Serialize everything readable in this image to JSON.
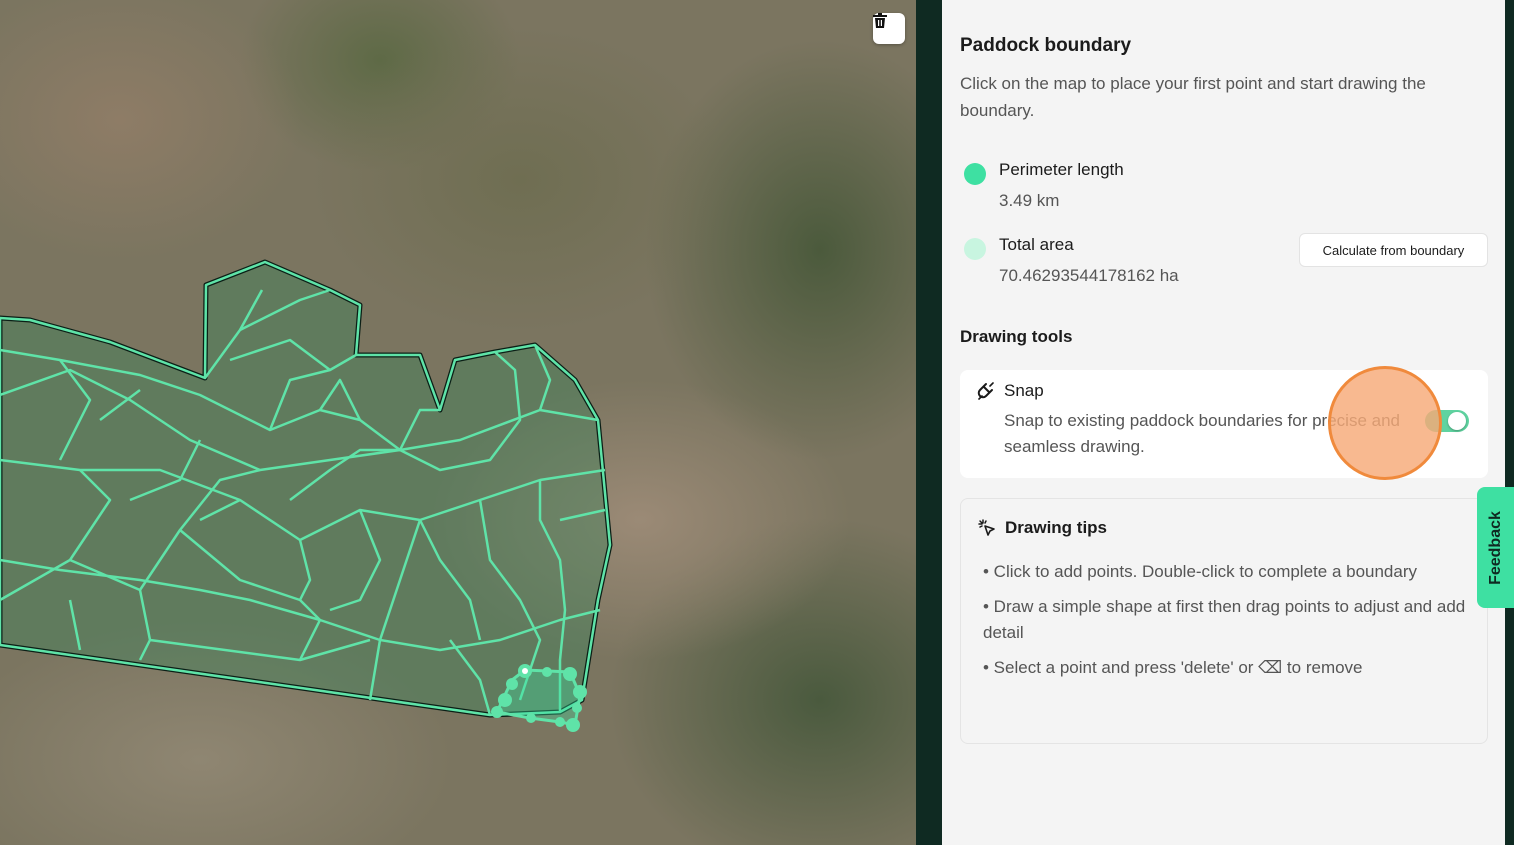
{
  "map": {
    "trash_icon": "trash-icon"
  },
  "panel": {
    "title": "Paddock boundary",
    "subtitle": "Click on the map to place your first point and start drawing the boundary.",
    "perimeter": {
      "label": "Perimeter length",
      "value": "3.49 km",
      "dot_color": "#3ee0a2"
    },
    "area": {
      "label": "Total area",
      "value": "70.46293544178162 ha",
      "dot_color": "#bff3dc"
    },
    "calculate_button": "Calculate from boundary",
    "drawing_tools_title": "Drawing tools",
    "snap": {
      "label": "Snap",
      "description": "Snap to existing paddock boundaries for precise and seamless drawing.",
      "enabled": true
    },
    "tips": {
      "title": "Drawing tips",
      "items": [
        "• Click to add points. Double-click to complete a boundary",
        "• Draw a simple shape at first then drag points to adjust and add detail",
        "• Select a point and press 'delete' or ⌫ to remove"
      ]
    }
  },
  "feedback_label": "Feedback",
  "colors": {
    "accent": "#3ee0a2",
    "dark": "#0f2a22",
    "cursor": "#f08a3c"
  }
}
